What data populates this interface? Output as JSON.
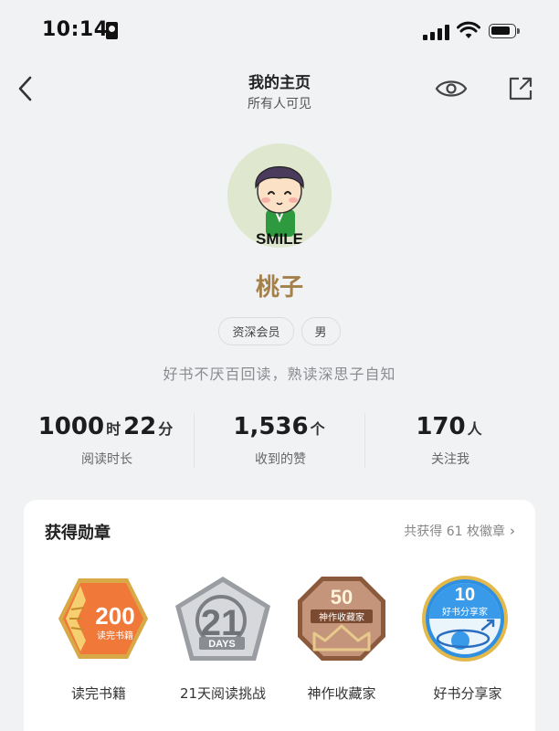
{
  "status": {
    "time": "10:14"
  },
  "nav": {
    "title": "我的主页",
    "subtitle": "所有人可见"
  },
  "profile": {
    "avatar_text": "SMILE",
    "name": "桃子",
    "tags": [
      "资深会员",
      "男"
    ],
    "signature": "好书不厌百回读，熟读深思子自知"
  },
  "stats": [
    {
      "value1": "1000",
      "unit1": "时",
      "value2": "22",
      "unit2": "分",
      "label": "阅读时长"
    },
    {
      "value1": "1,536",
      "unit1": "个",
      "label": "收到的赞"
    },
    {
      "value1": "170",
      "unit1": "人",
      "label": "关注我"
    }
  ],
  "medals_section": {
    "title": "获得勋章",
    "total_text": "共获得 61 枚徽章",
    "chevron": "›",
    "items": [
      {
        "label": "读完书籍",
        "number": "200",
        "caption": "读完书籍",
        "color": "#f07838",
        "icon": "hexagon-medal-icon"
      },
      {
        "label": "21天阅读挑战",
        "number": "21",
        "caption": "DAYS",
        "color": "#b8babd",
        "icon": "pentagon-medal-icon"
      },
      {
        "label": "神作收藏家",
        "number": "50",
        "caption": "神作收藏家",
        "color": "#b9876c",
        "icon": "octagon-medal-icon"
      },
      {
        "label": "好书分享家",
        "number": "10",
        "caption": "好书分享家",
        "color": "#2f8fe0",
        "icon": "circle-medal-icon"
      }
    ]
  }
}
